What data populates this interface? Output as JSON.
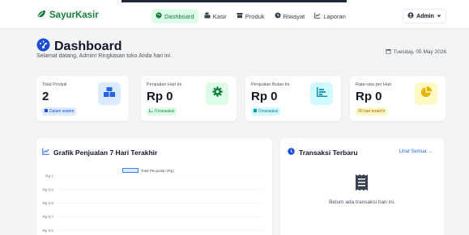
{
  "nav": {
    "brand": "SayurKasir",
    "links": [
      {
        "label": "Dashboard",
        "icon": "palette-icon",
        "active": true
      },
      {
        "label": "Kasir",
        "icon": "cash-register-icon",
        "active": false
      },
      {
        "label": "Produk",
        "icon": "boxes-icon",
        "active": false
      },
      {
        "label": "Riwayat",
        "icon": "history-icon",
        "active": false
      },
      {
        "label": "Laporan",
        "icon": "chart-line-icon",
        "active": false
      }
    ],
    "user": "Admin"
  },
  "header": {
    "title": "Dashboard",
    "subtitle": "Selamat datang, Admin! Ringkasan toko Anda hari ini.",
    "date": "Tuesday, 05 May 2026"
  },
  "stats": [
    {
      "label": "Total Produk",
      "value": "2",
      "badge": "Dalam sistem",
      "icon": "boxes-icon",
      "accent": "#2563eb"
    },
    {
      "label": "Penjualan Hari Ini",
      "value": "Rp 0",
      "badge": "0 transaksi",
      "icon": "gear-icon",
      "accent": "#15803d"
    },
    {
      "label": "Penjualan Bulan Ini",
      "value": "Rp 0",
      "badge": "0 transaksi",
      "icon": "chart-bar-icon",
      "accent": "#0891b2"
    },
    {
      "label": "Rata-rata per Hari",
      "value": "Rp 0",
      "badge": "30 hari terakhir",
      "icon": "pie-chart-icon",
      "accent": "#ca8a04"
    }
  ],
  "chart": {
    "title": "Grafik Penjualan 7 Hari Terakhir",
    "legend": "Total Penjualan (Rp)",
    "y_ticks": [
      "Rp 1",
      "Rp 0,9",
      "Rp 0,8",
      "Rp 0,7",
      "Rp 0,6"
    ]
  },
  "chart_data": {
    "type": "line",
    "title": "Grafik Penjualan 7 Hari Terakhir",
    "series": [
      {
        "name": "Total Penjualan (Rp)",
        "values": []
      }
    ],
    "y_tick_labels": [
      "Rp 1",
      "Rp 0,9",
      "Rp 0,8",
      "Rp 0,7",
      "Rp 0,6"
    ],
    "ylim": [
      0.6,
      1
    ],
    "grid": true,
    "legend": "top"
  },
  "transactions": {
    "title": "Transaksi Terbaru",
    "link": "Lihat Semua",
    "empty": "Belum ada transaksi hari ini."
  },
  "colors": {
    "brand": "#15803d",
    "active_bg": "#dcfce7",
    "link": "#2563eb",
    "page_bg": "#f3f4f6"
  }
}
